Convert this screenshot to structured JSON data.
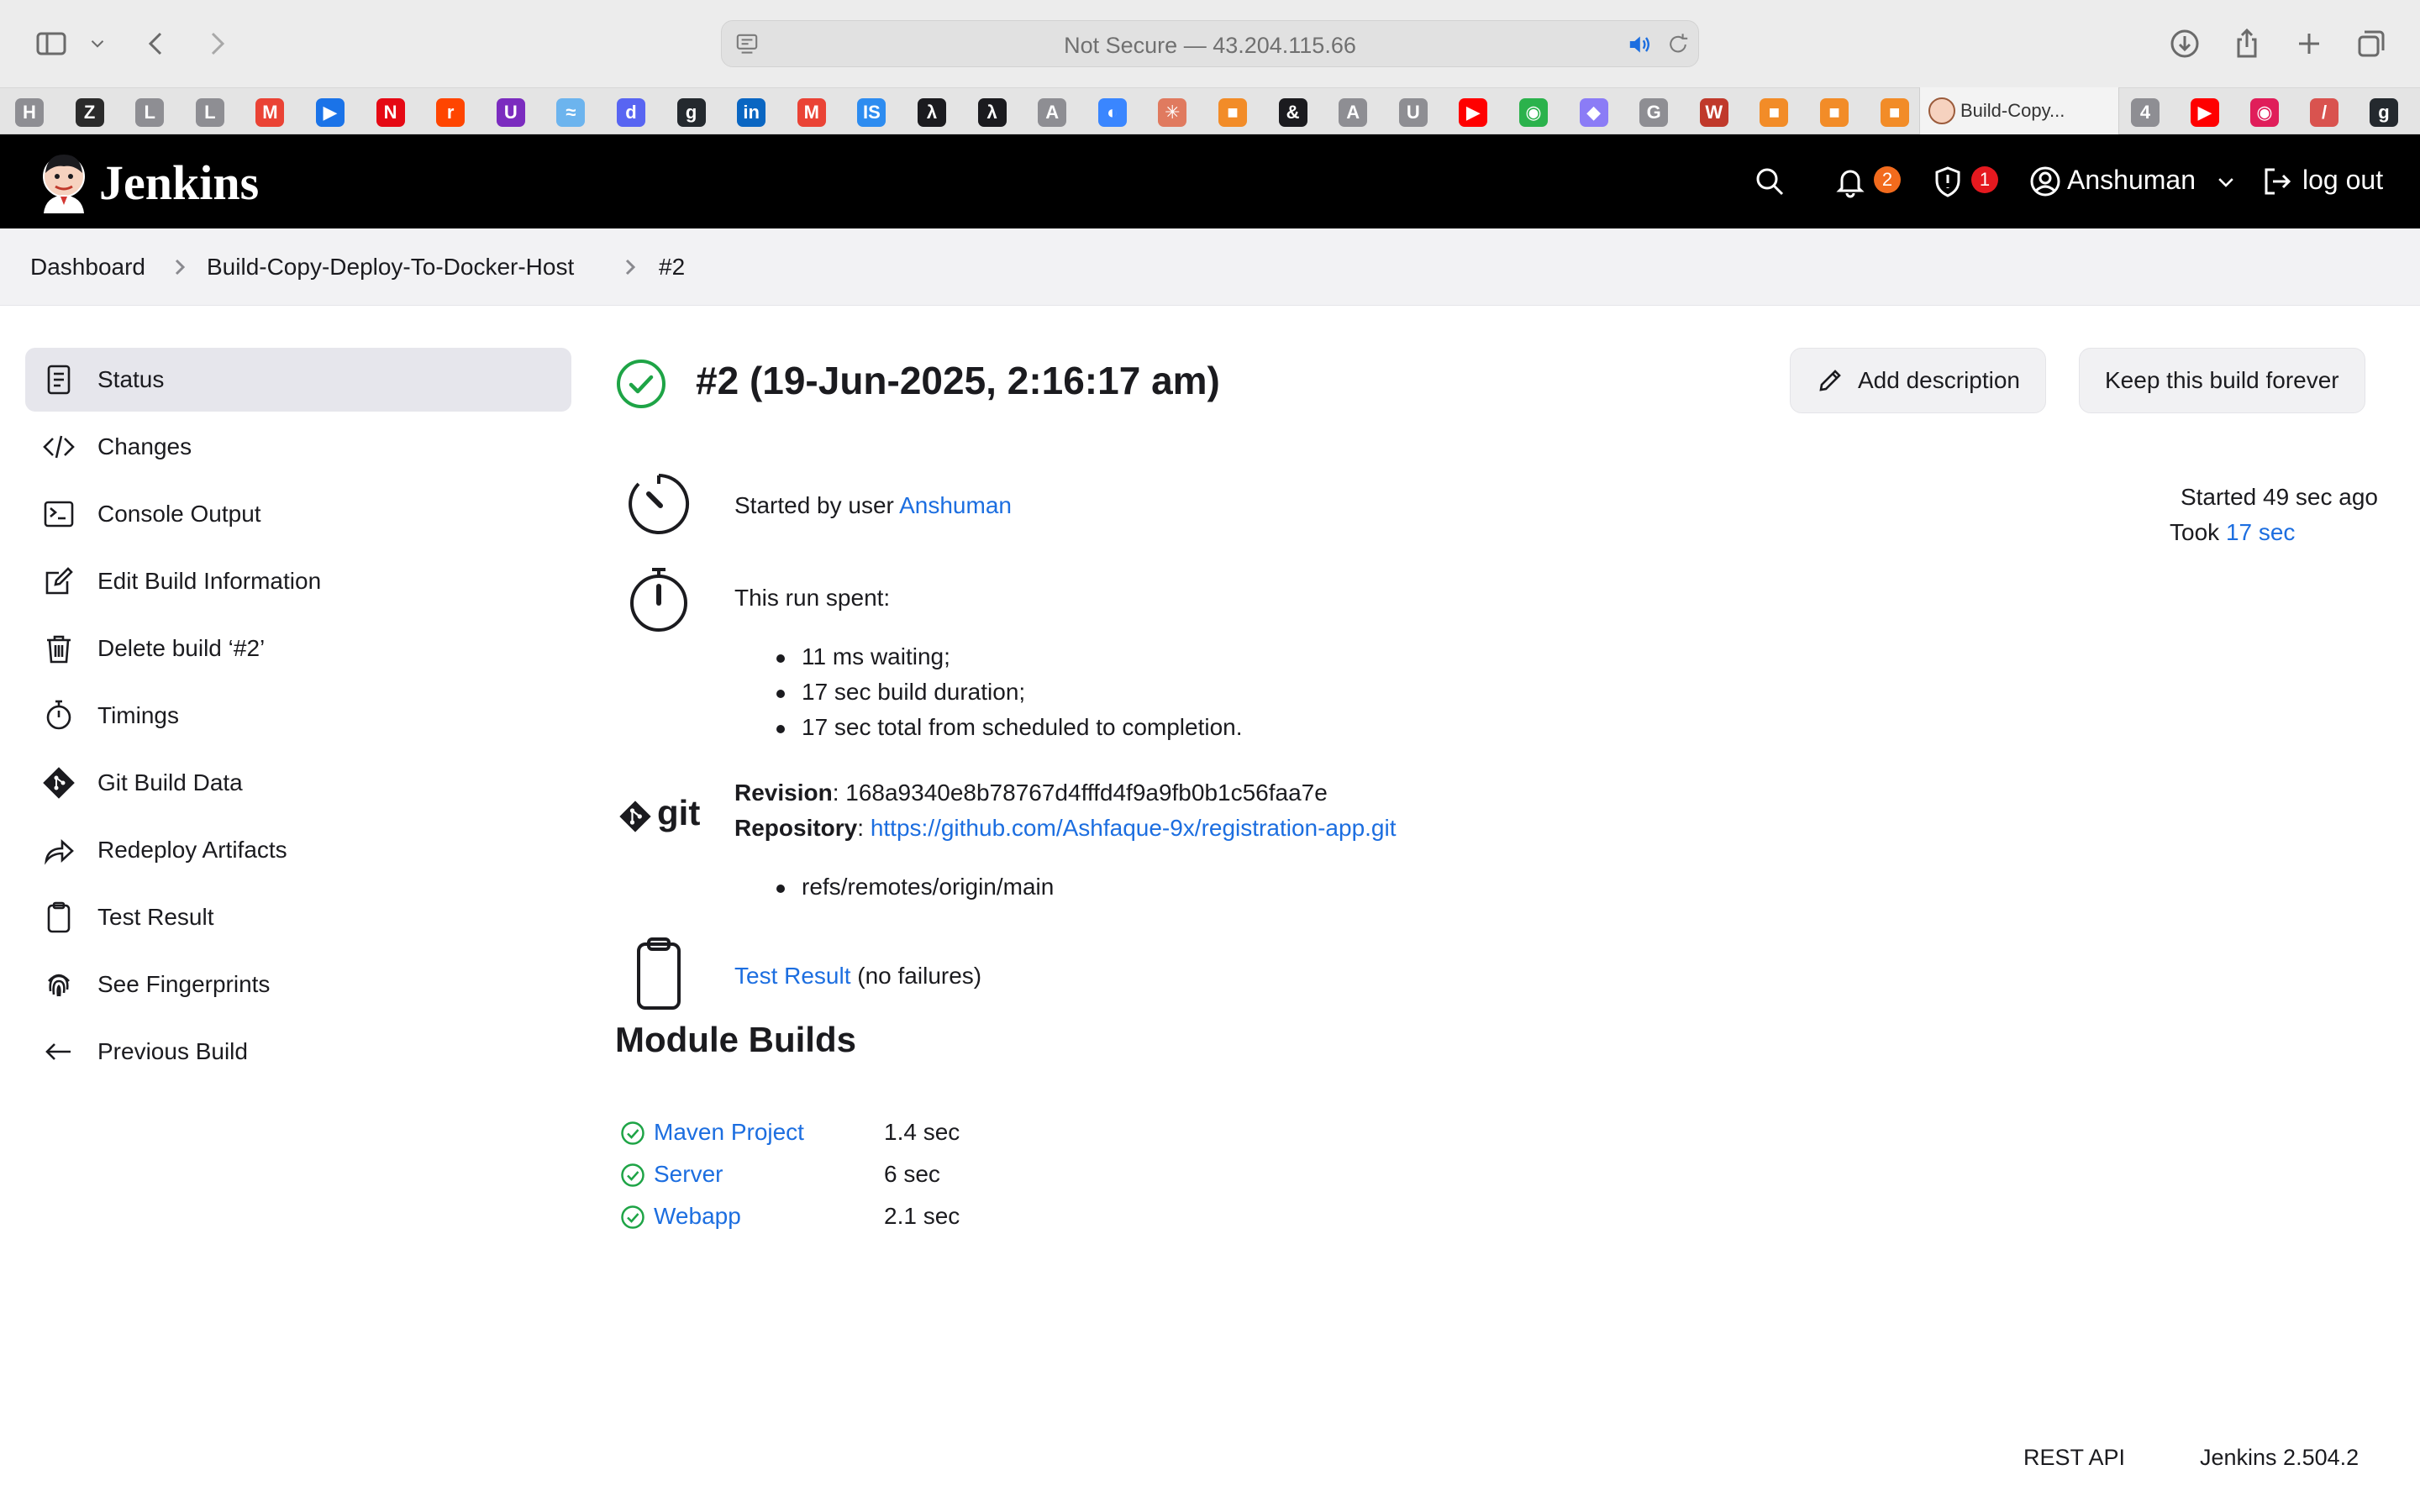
{
  "browser": {
    "address": "Not Secure — 43.204.115.66",
    "active_tab": "Build-Copy...",
    "bookmarks": [
      {
        "letter": "H",
        "color": "#8e8e93"
      },
      {
        "letter": "Z",
        "color": "#2b2b2b"
      },
      {
        "letter": "L",
        "color": "#8e8e93"
      },
      {
        "letter": "L",
        "color": "#8e8e93"
      },
      {
        "letter": "M",
        "color": "#ea4335"
      },
      {
        "letter": "▶",
        "color": "#1a73e8"
      },
      {
        "letter": "N",
        "color": "#e50914"
      },
      {
        "letter": "r",
        "color": "#ff4500"
      },
      {
        "letter": "U",
        "color": "#7b2cbf"
      },
      {
        "letter": "≈",
        "color": "#6cb4ee"
      },
      {
        "letter": "d",
        "color": "#5865f2"
      },
      {
        "letter": "g",
        "color": "#24292e"
      },
      {
        "letter": "in",
        "color": "#0a66c2"
      },
      {
        "letter": "M",
        "color": "#ea4335"
      },
      {
        "letter": "IS",
        "color": "#2d8cf0"
      },
      {
        "letter": "λ",
        "color": "#1b1b1f"
      },
      {
        "letter": "λ",
        "color": "#1b1b1f"
      },
      {
        "letter": "A",
        "color": "#8e8e93"
      },
      {
        "letter": "◐",
        "color": "#3a86ff"
      },
      {
        "letter": "✳",
        "color": "#e07a5f"
      },
      {
        "letter": "■",
        "color": "#f28c28"
      },
      {
        "letter": "&",
        "color": "#1b1b1f"
      },
      {
        "letter": "A",
        "color": "#8e8e93"
      },
      {
        "letter": "U",
        "color": "#8e8e93"
      },
      {
        "letter": "▶",
        "color": "#ff0000"
      },
      {
        "letter": "◉",
        "color": "#2bb24c"
      },
      {
        "letter": "◆",
        "color": "#8b7cf6"
      },
      {
        "letter": "G",
        "color": "#8e8e93"
      },
      {
        "letter": "W",
        "color": "#c0392b"
      },
      {
        "letter": "■",
        "color": "#f28c28"
      },
      {
        "letter": "■",
        "color": "#f28c28"
      },
      {
        "letter": "■",
        "color": "#f28c28"
      }
    ],
    "bookmarks_right": [
      {
        "letter": "4",
        "color": "#8e8e93"
      },
      {
        "letter": "▶",
        "color": "#ff0000"
      },
      {
        "letter": "◉",
        "color": "#e01e5a"
      },
      {
        "letter": "/",
        "color": "#d9534f"
      },
      {
        "letter": "g",
        "color": "#24292e"
      }
    ]
  },
  "header": {
    "brand": "Jenkins",
    "notifications_count": "2",
    "security_count": "1",
    "user": "Anshuman",
    "logout": "log out",
    "colors": {
      "notifications": "#f26b1d",
      "security": "#e5191f"
    }
  },
  "breadcrumb": [
    "Dashboard",
    "Build-Copy-Deploy-To-Docker-Host",
    "#2"
  ],
  "sidebar": {
    "items": [
      {
        "label": "Status",
        "icon": "status-icon"
      },
      {
        "label": "Changes",
        "icon": "code-icon"
      },
      {
        "label": "Console Output",
        "icon": "terminal-icon"
      },
      {
        "label": "Edit Build Information",
        "icon": "edit-icon"
      },
      {
        "label": "Delete build ‘#2’",
        "icon": "trash-icon"
      },
      {
        "label": "Timings",
        "icon": "stopwatch-icon"
      },
      {
        "label": "Git Build Data",
        "icon": "git-icon"
      },
      {
        "label": "Redeploy Artifacts",
        "icon": "redeploy-icon"
      },
      {
        "label": "Test Result",
        "icon": "clipboard-icon"
      },
      {
        "label": "See Fingerprints",
        "icon": "fingerprint-icon"
      },
      {
        "label": "Previous Build",
        "icon": "arrow-left-icon"
      }
    ]
  },
  "main": {
    "title": "#2 (19-Jun-2025, 2:16:17 am)",
    "add_description": "Add description",
    "keep_forever": "Keep this build forever",
    "started_by_prefix": "Started by user ",
    "started_by_user": "Anshuman",
    "started_ago": "Started 49 sec ago",
    "took_prefix": "Took ",
    "took_value": "17 sec",
    "run_spent": "This run spent:",
    "run_items": [
      "11 ms waiting;",
      "17 sec build duration;",
      "17 sec total from scheduled to completion."
    ],
    "revision_label": "Revision",
    "revision_value": ": 168a9340e8b78767d4fffd4f9a9fb0b1c56faa7e",
    "repository_label": "Repository",
    "repository_sep": ": ",
    "repository_url": "https://github.com/Ashfaque-9x/registration-app.git",
    "refs": [
      "refs/remotes/origin/main"
    ],
    "git_text": "git",
    "test_result_link": "Test Result",
    "test_result_suffix": " (no failures)",
    "module_builds_title": "Module Builds",
    "modules": [
      {
        "name": "Maven Project",
        "time": "1.4 sec"
      },
      {
        "name": "Server",
        "time": "6 sec"
      },
      {
        "name": "Webapp",
        "time": "2.1 sec"
      }
    ],
    "success_color": "#1ea446"
  },
  "footer": {
    "rest_api": "REST API",
    "version": "Jenkins 2.504.2"
  }
}
